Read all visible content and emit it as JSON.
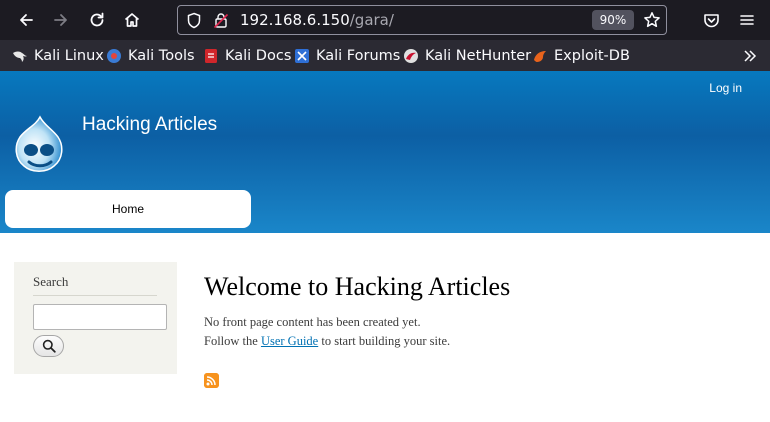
{
  "browser": {
    "url_host": "192.168.6.150",
    "url_path": "/gara/",
    "zoom": "90%"
  },
  "bookmarks": [
    {
      "label": "Kali Linux",
      "icon": "kali-dragon-icon"
    },
    {
      "label": "Kali Tools",
      "icon": "kali-tools-icon"
    },
    {
      "label": "Kali Docs",
      "icon": "kali-docs-icon"
    },
    {
      "label": "Kali Forums",
      "icon": "kali-forums-icon"
    },
    {
      "label": "Kali NetHunter",
      "icon": "nethunter-icon"
    },
    {
      "label": "Exploit-DB",
      "icon": "exploit-db-icon"
    }
  ],
  "site": {
    "login": "Log in",
    "name": "Hacking Articles",
    "nav_home": "Home"
  },
  "sidebar": {
    "title": "Search",
    "search_value": ""
  },
  "content": {
    "heading": "Welcome to Hacking Articles",
    "line1": "No front page content has been created yet.",
    "line2_before": "Follow the ",
    "line2_link": "User Guide",
    "line2_after": " to start building your site."
  },
  "colors": {
    "header_blue": "#0c5fa4",
    "link": "#0071b3",
    "feed": "#f7931e"
  }
}
